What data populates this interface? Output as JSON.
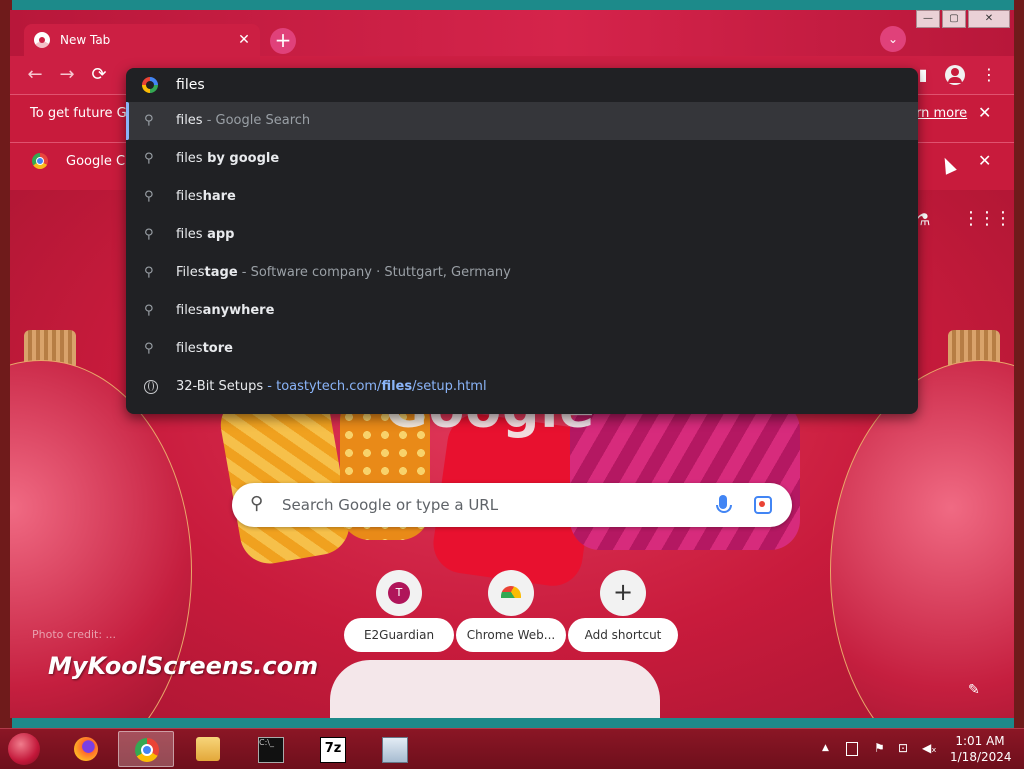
{
  "browser": {
    "tab": {
      "title": "New Tab",
      "close": "✕"
    },
    "new_tab_symbol": "+",
    "tab_search_symbol": "⌄",
    "window_controls": {
      "minimize": "—",
      "maximize": "▢",
      "close": "✕"
    }
  },
  "toolbar": {
    "back": "←",
    "forward": "→",
    "reload": "⟳",
    "side_panel": "▮",
    "menu": "⋮"
  },
  "infobar1": {
    "text": "To get future G",
    "learn_more": "earn more",
    "close": "✕"
  },
  "infobar2": {
    "text": "Google C",
    "close": "✕"
  },
  "omnibox": {
    "input_value": "files",
    "suggestions": [
      {
        "icon": "search-icon",
        "pre": "files",
        "bold": "",
        "post": " - Google Search",
        "selected": true
      },
      {
        "icon": "search-icon",
        "pre": "files",
        "bold": " by google",
        "post": ""
      },
      {
        "icon": "search-icon",
        "pre": "files",
        "bold": "hare",
        "post": ""
      },
      {
        "icon": "search-icon",
        "pre": "files",
        "bold": " app",
        "post": ""
      },
      {
        "icon": "search-icon",
        "pre": "Files",
        "bold": "tage",
        "post": " - Software company · Stuttgart, Germany"
      },
      {
        "icon": "search-icon",
        "pre": "files",
        "bold": "anywhere",
        "post": ""
      },
      {
        "icon": "search-icon",
        "pre": "files",
        "bold": "tore",
        "post": ""
      },
      {
        "icon": "globe-icon",
        "pre": "32-Bit Setups",
        "bold": "",
        "post": "",
        "url_pre": " - toastytech.com/",
        "url_bold": "files",
        "url_post": "/setup.html"
      }
    ]
  },
  "ntp": {
    "logo_text": "Google",
    "search_placeholder": "Search Google or type a URL",
    "shortcuts": [
      {
        "label": "E2Guardian",
        "initial": "T"
      },
      {
        "label": "Chrome Web...",
        "initial": ""
      },
      {
        "label": "Add shortcut",
        "initial": "+"
      }
    ],
    "brand": "MyKoolScreens.com",
    "photo_credit": "Photo credit: ...",
    "customize_icon": "✎"
  },
  "taskbar": {
    "apps": [
      "firefox",
      "chrome",
      "file-explorer",
      "command-prompt",
      "7zip",
      "task-manager"
    ],
    "clock_time": "1:01 AM",
    "clock_date": "1/18/2024",
    "tray_up": "▲"
  },
  "colors": {
    "accent": "#c81b3c",
    "omnibox_bg": "#202124",
    "link": "#8ab4f8"
  }
}
